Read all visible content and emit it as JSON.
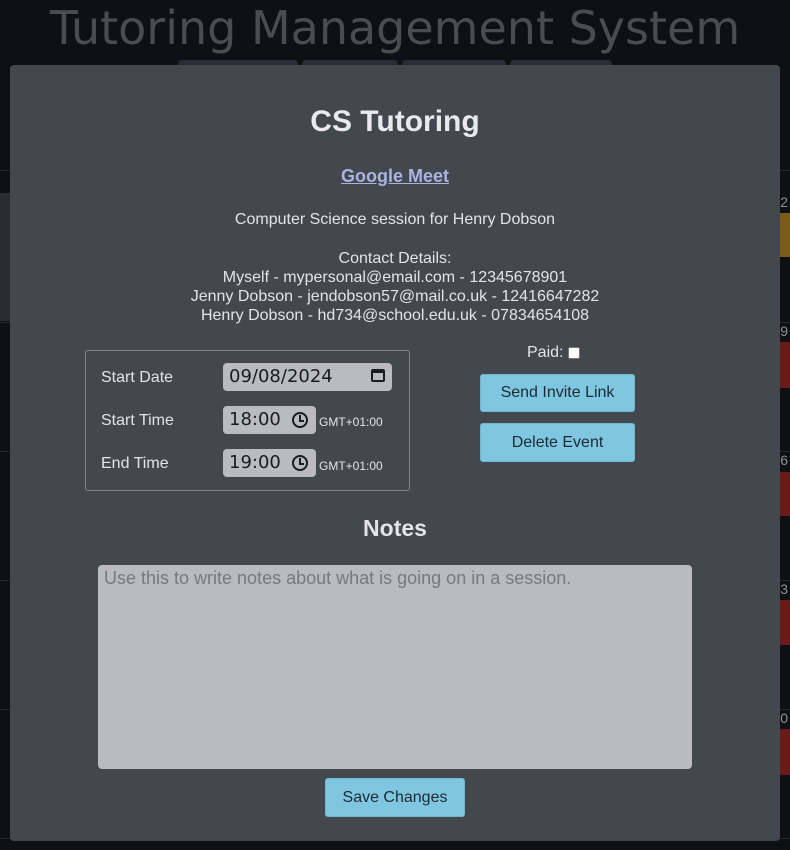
{
  "background": {
    "app_title": "Tutoring Management System",
    "row_numbers": [
      "2",
      "9",
      "6",
      "3",
      "0"
    ]
  },
  "modal": {
    "title": "CS Tutoring",
    "meeting_link": "Google Meet",
    "description": "Computer Science session for Henry Dobson",
    "contact": {
      "heading": "Contact Details:",
      "lines": [
        "Myself - mypersonal@email.com - 12345678901",
        "Jenny Dobson - jendobson57@mail.co.uk - 12416647282",
        "Henry Dobson - hd734@school.edu.uk - 07834654108"
      ]
    },
    "schedule": {
      "start_date_label": "Start Date",
      "start_date_value": "09/08/2024",
      "start_time_label": "Start Time",
      "start_time_value": "18:00",
      "end_time_label": "End Time",
      "end_time_value": "19:00",
      "timezone": "GMT+01:00"
    },
    "paid_label": "Paid:",
    "paid_checked": false,
    "send_invite_label": "Send Invite Link",
    "delete_event_label": "Delete Event",
    "notes_heading": "Notes",
    "notes_placeholder": "Use this to write notes about what is going on in a session.",
    "save_label": "Save Changes"
  },
  "colors": {
    "modal_bg": "#43474e",
    "button_bg": "#7fc6e0",
    "link": "#aab3e1",
    "input_bg": "#babac1",
    "accent_gold": "#7a5c17",
    "accent_red": "#6b1a1a"
  }
}
